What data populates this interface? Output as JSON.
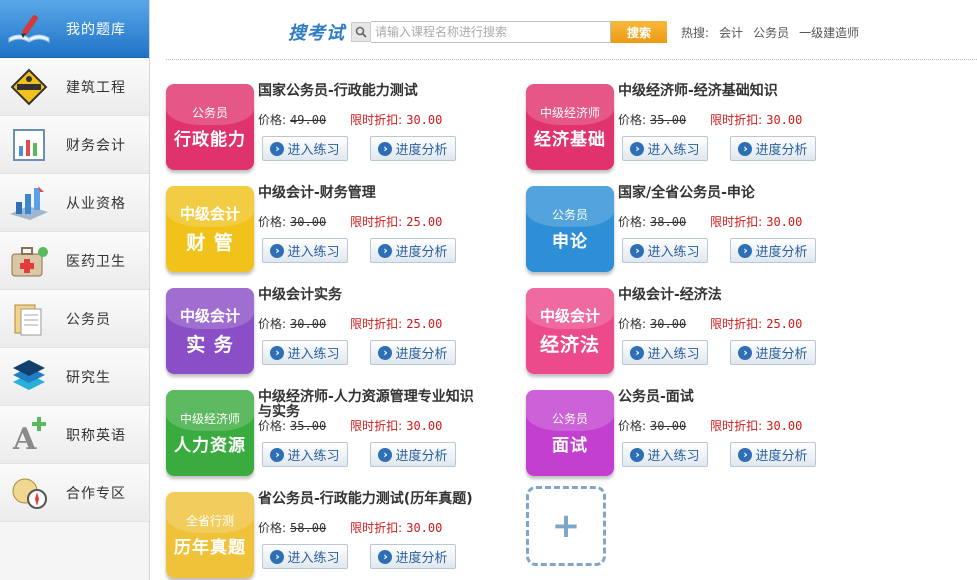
{
  "sidebar": {
    "items": [
      {
        "label": "我的题库",
        "icon": "book-pen-icon",
        "active": true
      },
      {
        "label": "建筑工程",
        "icon": "construction-sign-icon"
      },
      {
        "label": "财务会计",
        "icon": "ledger-chart-icon"
      },
      {
        "label": "从业资格",
        "icon": "bar-chart-3d-icon"
      },
      {
        "label": "医药卫生",
        "icon": "medical-kit-icon"
      },
      {
        "label": "公务员",
        "icon": "documents-icon"
      },
      {
        "label": "研究生",
        "icon": "layers-icon"
      },
      {
        "label": "职称英语",
        "icon": "letter-a-plus-icon"
      },
      {
        "label": "合作专区",
        "icon": "compass-globe-icon"
      }
    ]
  },
  "search": {
    "brand": "搜考试",
    "placeholder": "请输入课程名称进行搜索",
    "button": "搜索",
    "hot_label": "热搜:",
    "hot_terms": [
      "会计",
      "公务员",
      "一级建造师"
    ]
  },
  "labels": {
    "price": "价格:",
    "discount": "限时折扣:",
    "practice": "进入练习",
    "analysis": "进度分析"
  },
  "courses": [
    {
      "title": "国家公务员-行政能力测试",
      "price": "49.00",
      "discount": "30.00",
      "thumb_top": "公务员",
      "thumb_bottom": "行政能力",
      "color": "#e0336d"
    },
    {
      "title": "中级经济师-经济基础知识",
      "price": "35.00",
      "discount": "30.00",
      "thumb_top": "中级经济师",
      "thumb_bottom": "经济基础",
      "color": "#e0336d"
    },
    {
      "title": "中级会计-财务管理",
      "price": "30.00",
      "discount": "25.00",
      "thumb_top": "中级会计",
      "thumb_bottom": "财 管",
      "color": "#f0c21a"
    },
    {
      "title": "国家/全省公务员-申论",
      "price": "38.00",
      "discount": "30.00",
      "thumb_top": "公务员",
      "thumb_bottom": "申论",
      "color": "#2e8fd6"
    },
    {
      "title": "中级会计实务",
      "price": "30.00",
      "discount": "25.00",
      "thumb_top": "中级会计",
      "thumb_bottom": "实 务",
      "color": "#8a4fc6"
    },
    {
      "title": "中级会计-经济法",
      "price": "30.00",
      "discount": "25.00",
      "thumb_top": "中级会计",
      "thumb_bottom": "经济法",
      "color": "#ec4a8a"
    },
    {
      "title": "中级经济师-人力资源管理专业知识与实务",
      "price": "35.00",
      "discount": "30.00",
      "thumb_top": "中级经济师",
      "thumb_bottom": "人力资源",
      "color": "#3aab3e"
    },
    {
      "title": "公务员-面试",
      "price": "30.00",
      "discount": "30.00",
      "thumb_top": "公务员",
      "thumb_bottom": "面试",
      "color": "#c23fcf"
    },
    {
      "title": "省公务员-行政能力测试(历年真题)",
      "price": "58.00",
      "discount": "30.00",
      "thumb_top": "全省行测",
      "thumb_bottom": "历年真题",
      "color": "#efc23a"
    }
  ],
  "add_icon": "plus-icon"
}
